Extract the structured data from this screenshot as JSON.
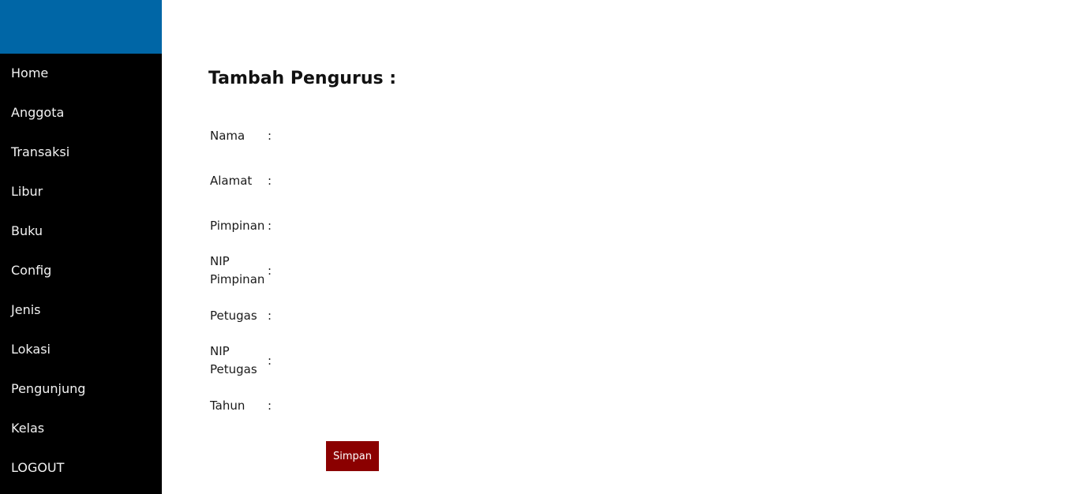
{
  "sidebar": {
    "header_color": "#0066a6",
    "items": [
      {
        "label": "Home"
      },
      {
        "label": "Anggota"
      },
      {
        "label": "Transaksi"
      },
      {
        "label": "Libur"
      },
      {
        "label": "Buku"
      },
      {
        "label": "Config"
      },
      {
        "label": "Jenis"
      },
      {
        "label": "Lokasi"
      },
      {
        "label": "Pengunjung"
      },
      {
        "label": "Kelas"
      },
      {
        "label": "LOGOUT"
      }
    ]
  },
  "form": {
    "title": "Tambah Pengurus :",
    "separator": ":",
    "fields": [
      {
        "label": "Nama",
        "value": ""
      },
      {
        "label": "Alamat",
        "value": ""
      },
      {
        "label": "Pimpinan",
        "value": ""
      },
      {
        "label": "NIP Pimpinan",
        "value": ""
      },
      {
        "label": "Petugas",
        "value": ""
      },
      {
        "label": "NIP Petugas",
        "value": ""
      },
      {
        "label": "Tahun",
        "value": ""
      }
    ],
    "submit_label": "Simpan",
    "submit_color": "#8b0000"
  }
}
